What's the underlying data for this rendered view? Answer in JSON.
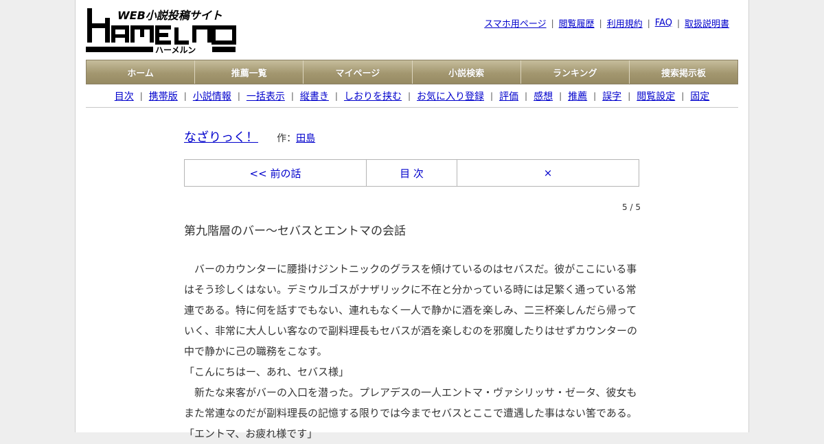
{
  "site": {
    "logo_text": "HAMELN",
    "logo_tagline": "WEB小説投稿サイト",
    "logo_reading": "ハーメルン"
  },
  "toplinks": [
    "スマホ用ページ",
    "閲覧履歴",
    "利用規約",
    "FAQ",
    "取扱説明書"
  ],
  "mainnav": [
    "ホーム",
    "推薦一覧",
    "マイページ",
    "小説検索",
    "ランキング",
    "捜索掲示板"
  ],
  "subnav": [
    "目次",
    "携帯版",
    "小説情報",
    "一括表示",
    "縦書き",
    "しおりを挟む",
    "お気に入り登録",
    "評価",
    "感想",
    "推薦",
    "誤字",
    "閲覧設定",
    "固定"
  ],
  "novel": {
    "title": "なざりっく！",
    "author_prefix": "作：",
    "author": "田島"
  },
  "chapnav": {
    "prev": "<< 前の話",
    "toc": "目 次",
    "close": "×"
  },
  "page_count": "5 / 5",
  "chapter_title": "第九階層のバー～セバスとエントマの会話",
  "body_lines": [
    "　バーのカウンターに腰掛けジントニックのグラスを傾けているのはセバスだ。彼がここにいる事",
    "はそう珍しくはない。デミウルゴスがナザリックに不在と分かっている時には足繁く通っている常",
    "連である。特に何を話すでもない、連れもなく一人で静かに酒を楽しみ、二三杯楽しんだら帰って",
    "いく、非常に大人しい客なので副料理長もセバスが酒を楽しむのを邪魔したりはせずカウンターの",
    "中で静かに己の職務をこなす。",
    "「こんにちはー、あれ、セバス様」",
    "　新たな来客がバーの入口を潜った。プレアデスの一人エントマ・ヴァシリッサ・ゼータ、彼女も",
    "また常連なのだが副料理長の記憶する限りでは今までセバスとここで遭遇した事はない筈である。",
    "「エントマ、お疲れ様です」"
  ],
  "colors": {
    "nav_bg": "#a39770",
    "link": "#0000cc",
    "page_bg": "#eeeeee"
  }
}
